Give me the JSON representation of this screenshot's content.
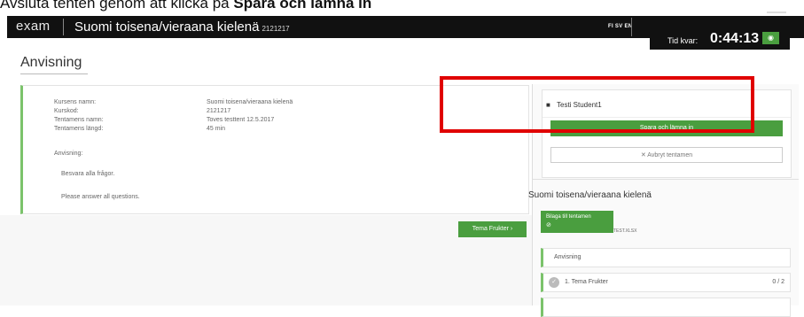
{
  "caption": {
    "prefix": "Avsluta tenten genom att klicka på",
    "bold": "Spara och lämna in"
  },
  "header": {
    "logo": "exam",
    "title": "Suomi toisena/vieraana kielenä",
    "course_code": "2121217",
    "languages": "FI SV EN"
  },
  "timer": {
    "label": "Tid kvar:",
    "value": "0:44:13"
  },
  "page": {
    "title": "Anvisning"
  },
  "info": {
    "course_name_label": "Kursens namn:",
    "course_name_value": "Suomi toisena/vieraana kielenä",
    "course_code_label": "Kurskod:",
    "course_code_value": "2121217",
    "exam_name_label": "Tentamens namn:",
    "exam_name_value": "Toves testtent 12.5.2017",
    "exam_length_label": "Tentamens längd:",
    "exam_length_value": "45 min",
    "instructions_label": "Anvisning:",
    "instruction_sv": "Besvara alla frågor.",
    "instruction_en": "Please answer all questions."
  },
  "buttons": {
    "next": "Tema Frukter"
  },
  "sidebar": {
    "student_name": "Testi Student1",
    "submit": "Spara och lämna in",
    "cancel": "Avbryt tentamen",
    "course_name": "Suomi toisena/vieraana kielenä",
    "attachment_button": "Bilaga till tentamen",
    "attachment_file": "TEST.XLSX",
    "nav": [
      {
        "label": "Anvisning"
      },
      {
        "label": "1. Tema Frukter",
        "count": "0 / 2"
      }
    ]
  },
  "colors": {
    "accent": "#4a9e3f",
    "highlight": "#e00000",
    "topbar": "#111111"
  },
  "icons": {
    "user": "user-icon",
    "timer_toggle": "eye-off-icon",
    "cancel": "close-icon",
    "attachment": "paperclip-icon",
    "next": "chevron-right-icon",
    "status": "check-circle-icon"
  }
}
